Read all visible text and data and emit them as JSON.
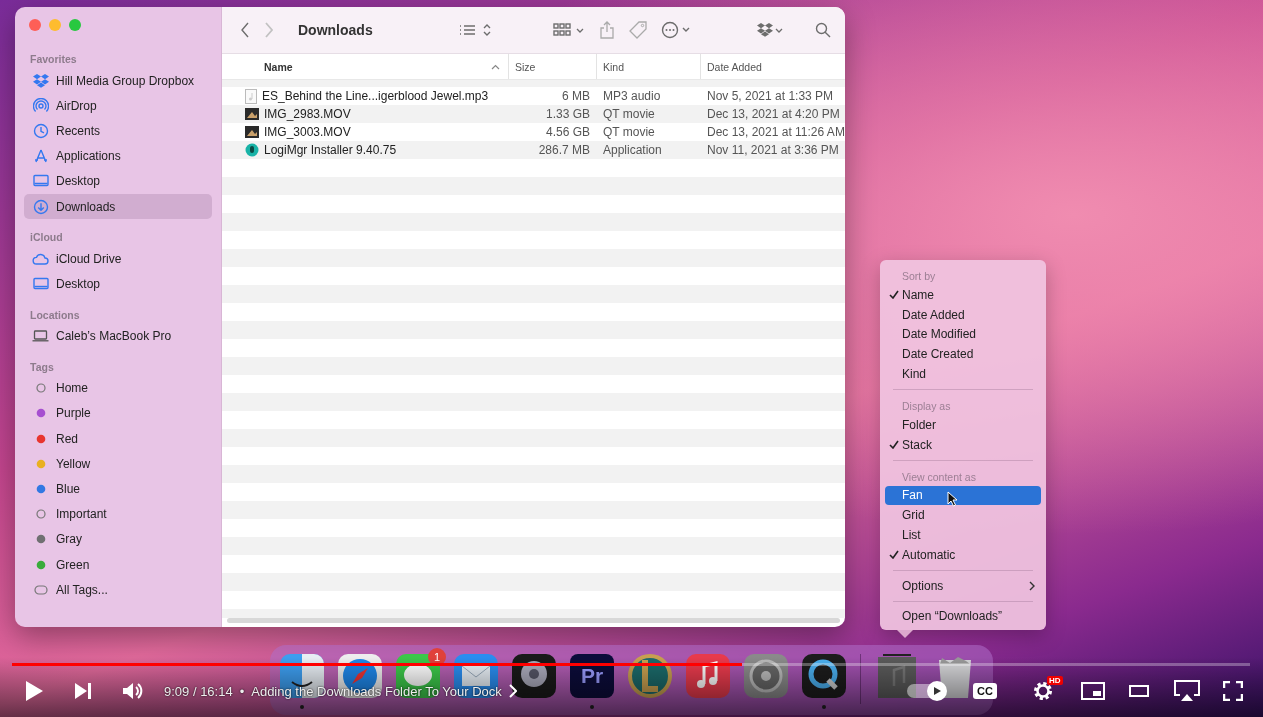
{
  "finder": {
    "title": "Downloads",
    "sidebar": [
      {
        "heading": "Favorites",
        "items": [
          {
            "label": "Hill Media Group Dropbox",
            "kind": "dropbox",
            "selected": false
          },
          {
            "label": "AirDrop",
            "kind": "airdrop",
            "selected": false
          },
          {
            "label": "Recents",
            "kind": "recents",
            "selected": false
          },
          {
            "label": "Applications",
            "kind": "applications",
            "selected": false
          },
          {
            "label": "Desktop",
            "kind": "desktop",
            "selected": false
          },
          {
            "label": "Downloads",
            "kind": "downloads",
            "selected": true
          }
        ]
      },
      {
        "heading": "iCloud",
        "items": [
          {
            "label": "iCloud Drive",
            "kind": "cloud",
            "selected": false
          },
          {
            "label": "Desktop",
            "kind": "desktop",
            "selected": false
          }
        ]
      },
      {
        "heading": "Locations",
        "items": [
          {
            "label": "Caleb’s MacBook Pro",
            "kind": "computer",
            "selected": false
          }
        ]
      },
      {
        "heading": "Tags",
        "items": [
          {
            "label": "Home",
            "kind": "tag",
            "selected": false
          },
          {
            "label": "Purple",
            "kind": "tag",
            "color": "#a64fd0",
            "selected": false
          },
          {
            "label": "Red",
            "kind": "tag",
            "color": "#e8352f",
            "selected": false
          },
          {
            "label": "Yellow",
            "kind": "tag",
            "color": "#e9b021",
            "selected": false
          },
          {
            "label": "Blue",
            "kind": "tag",
            "color": "#3278e3",
            "selected": false
          },
          {
            "label": "Important",
            "kind": "tag",
            "selected": false
          },
          {
            "label": "Gray",
            "kind": "tag",
            "color": "#707072",
            "selected": false
          },
          {
            "label": "Green",
            "kind": "tag",
            "color": "#3aab3c",
            "selected": false
          },
          {
            "label": "All Tags...",
            "kind": "alltags",
            "selected": false
          }
        ]
      }
    ],
    "columns": [
      {
        "label": "Name",
        "sorted": true
      },
      {
        "label": "Size",
        "sorted": false
      },
      {
        "label": "Kind",
        "sorted": false
      },
      {
        "label": "Date Added",
        "sorted": false
      }
    ],
    "rows": [
      {
        "kind": "audio",
        "name": "ES_Behind the Line...igerblood Jewel.mp3",
        "size": "6 MB",
        "file_kind": "MP3 audio",
        "date_added": "Nov 5, 2021 at 1:33 PM"
      },
      {
        "kind": "movie",
        "name": "IMG_2983.MOV",
        "size": "1.33 GB",
        "file_kind": "QT movie",
        "date_added": "Dec 13, 2021 at 4:20 PM"
      },
      {
        "kind": "movie",
        "name": "IMG_3003.MOV",
        "size": "4.56 GB",
        "file_kind": "QT movie",
        "date_added": "Dec 13, 2021 at 11:26 AM"
      },
      {
        "kind": "application",
        "name": "LogiMgr Installer 9.40.75",
        "size": "286.7 MB",
        "file_kind": "Application",
        "date_added": "Nov 11, 2021 at 3:36 PM"
      }
    ]
  },
  "dock_menu": {
    "sections": [
      {
        "heading": "Sort by",
        "items": [
          {
            "label": "Name",
            "checked": true,
            "selected": false
          },
          {
            "label": "Date Added",
            "checked": false,
            "selected": false
          },
          {
            "label": "Date Modified",
            "checked": false,
            "selected": false
          },
          {
            "label": "Date Created",
            "checked": false,
            "selected": false
          },
          {
            "label": "Kind",
            "checked": false,
            "selected": false
          }
        ]
      },
      {
        "heading": "Display as",
        "items": [
          {
            "label": "Folder",
            "checked": false,
            "selected": false
          },
          {
            "label": "Stack",
            "checked": true,
            "selected": false
          }
        ]
      },
      {
        "heading": "View content as",
        "items": [
          {
            "label": "Fan",
            "checked": false,
            "selected": true
          },
          {
            "label": "Grid",
            "checked": false,
            "selected": false
          },
          {
            "label": "List",
            "checked": false,
            "selected": false
          },
          {
            "label": "Automatic",
            "checked": true,
            "selected": false
          }
        ]
      },
      {
        "items": [
          {
            "label": "Options",
            "kind": "submenu",
            "checked": false,
            "selected": false
          }
        ]
      },
      {
        "items": [
          {
            "label": "Open “Downloads”",
            "kind": "plain",
            "checked": false,
            "selected": false
          }
        ]
      }
    ]
  },
  "dock": {
    "apps": [
      {
        "kind": "finder",
        "running": true
      },
      {
        "kind": "safari",
        "running": false
      },
      {
        "kind": "messages",
        "running": false,
        "badge": "1"
      },
      {
        "kind": "mail",
        "running": false
      },
      {
        "kind": "logic",
        "running": false
      },
      {
        "kind": "premiere",
        "running": true,
        "label": "Pr"
      },
      {
        "kind": "league",
        "running": false
      },
      {
        "kind": "music",
        "running": false
      },
      {
        "kind": "settings",
        "running": false
      },
      {
        "kind": "quicktime",
        "running": true
      },
      {
        "kind": "separator"
      },
      {
        "kind": "stack",
        "running": false
      },
      {
        "kind": "trash",
        "running": false
      }
    ]
  },
  "player": {
    "progress": {
      "level": 0.59
    },
    "time": "9:09 / 16:14",
    "separator": "•",
    "chapter": "Adding the Downloads Folder To Your Dock",
    "autoplay": true,
    "captions": "CC",
    "quality_badge": "HD"
  }
}
